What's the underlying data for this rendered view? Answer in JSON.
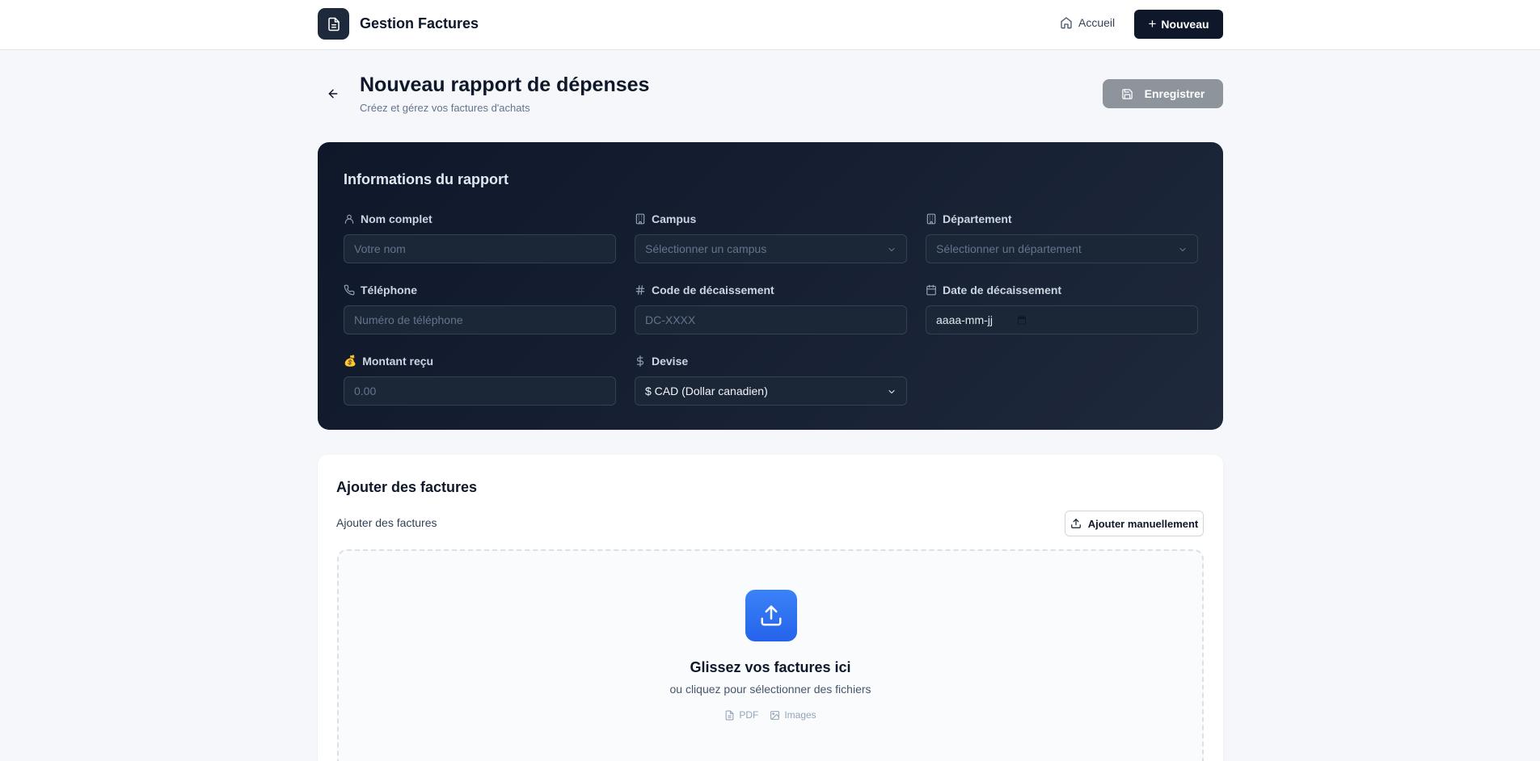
{
  "header": {
    "brand_name": "Gestion Factures",
    "nav_home": "Accueil",
    "nav_new": "Nouveau"
  },
  "page": {
    "title": "Nouveau rapport de dépenses",
    "subtitle": "Créez et gérez vos factures d'achats",
    "save_label": "Enregistrer"
  },
  "report_info": {
    "title": "Informations du rapport",
    "fields": {
      "name": {
        "label": "Nom complet",
        "placeholder": "Votre nom"
      },
      "campus": {
        "label": "Campus",
        "placeholder": "Sélectionner un campus"
      },
      "department": {
        "label": "Département",
        "placeholder": "Sélectionner un département"
      },
      "phone": {
        "label": "Téléphone",
        "placeholder": "Numéro de téléphone"
      },
      "code": {
        "label": "Code de décaissement",
        "placeholder": "DC-XXXX"
      },
      "date": {
        "label": "Date de décaissement",
        "placeholder": "aaaa-mm-jj"
      },
      "amount": {
        "label": "Montant reçu",
        "placeholder": "0.00",
        "icon": "💰"
      },
      "currency": {
        "label": "Devise",
        "value": "$ CAD (Dollar canadien)"
      }
    }
  },
  "factures": {
    "title": "Ajouter des factures",
    "subtitle": "Ajouter des factures",
    "manual_label": "Ajouter manuellement",
    "dropzone": {
      "title": "Glissez vos factures ici",
      "subtitle": "ou cliquez pour sélectionner des fichiers",
      "types": [
        "PDF",
        "Images"
      ]
    }
  },
  "colors": {
    "primary_dark": "#0f172a",
    "card_dark": "#1e293b",
    "accent_blue": "#3b82f6",
    "save_disabled": "#8e949c"
  }
}
